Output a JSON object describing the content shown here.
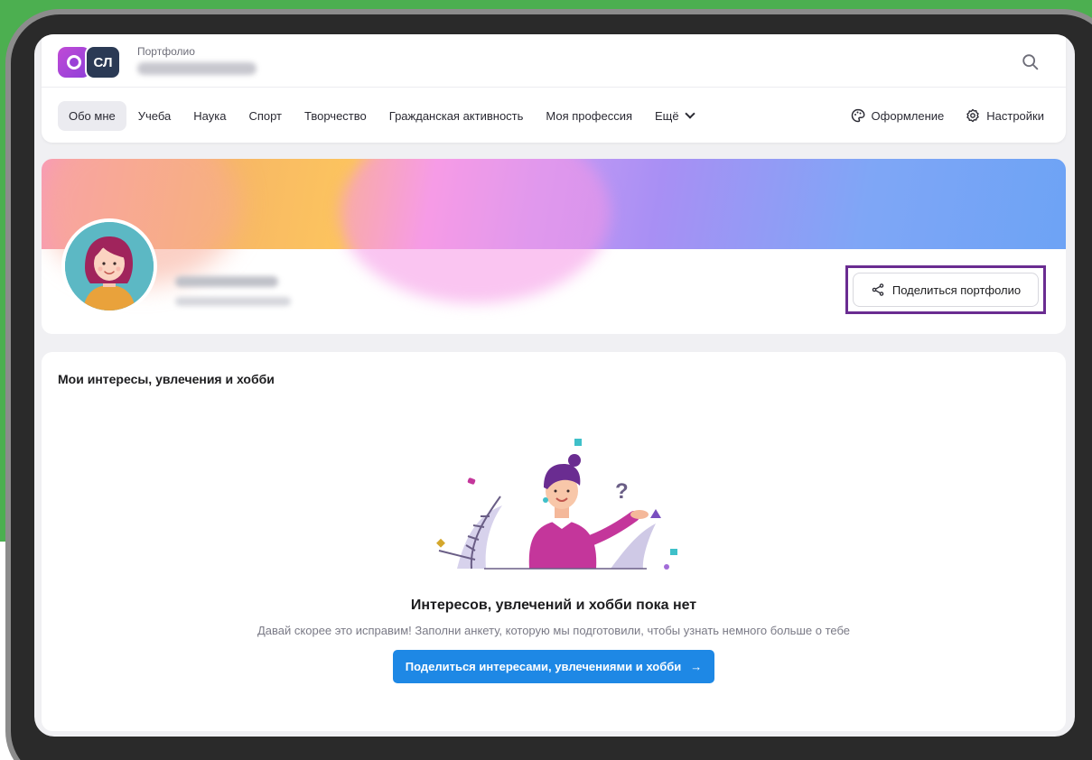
{
  "header": {
    "app_title": "Портфолио",
    "logo_text": "СЛ",
    "icons": {
      "search": "search-icon",
      "logo": "portfolio-logo-icon"
    }
  },
  "tabs": [
    {
      "label": "Обо мне",
      "active": true
    },
    {
      "label": "Учеба",
      "active": false
    },
    {
      "label": "Наука",
      "active": false
    },
    {
      "label": "Спорт",
      "active": false
    },
    {
      "label": "Творчество",
      "active": false
    },
    {
      "label": "Гражданская активность",
      "active": false
    },
    {
      "label": "Моя профессия",
      "active": false
    },
    {
      "label": "Ещё",
      "active": false
    }
  ],
  "actions": {
    "appearance_label": "Оформление",
    "settings_label": "Настройки"
  },
  "profile": {
    "share_label": "Поделиться портфолио"
  },
  "interests": {
    "title": "Мои интересы, увлечения и хобби",
    "empty_title": "Интересов, увлечений и хобби пока нет",
    "empty_subtitle": "Давай скорее это исправим! Заполни анкету, которую мы подготовили, чтобы узнать немного больше о тебе",
    "cta_label": "Поделиться интересами, увлечениями и хобби",
    "cta_arrow": "→"
  },
  "colors": {
    "accent": "#1e88e5",
    "highlight_border": "#6a2c91",
    "background": "#4caf50"
  }
}
